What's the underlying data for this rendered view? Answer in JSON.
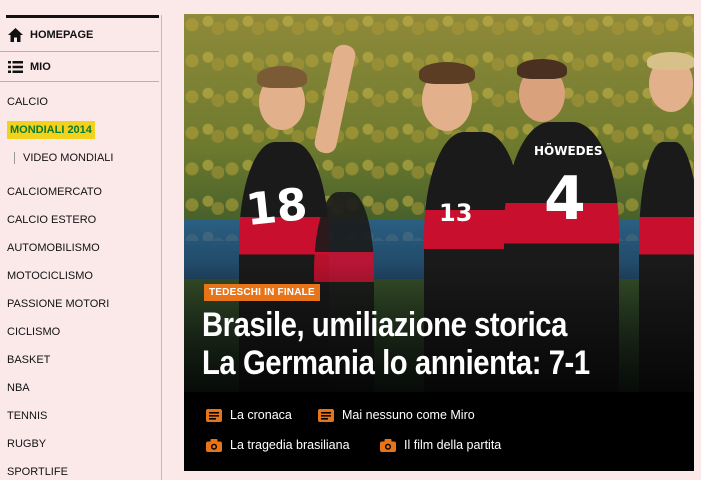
{
  "sidebar": {
    "homepage": "HOMEPAGE",
    "mio": "MIO",
    "items": [
      {
        "label": "CALCIO"
      },
      {
        "label": "MONDIALI 2014"
      },
      {
        "label": "VIDEO MONDIALI"
      },
      {
        "label": "CALCIOMERCATO"
      },
      {
        "label": "CALCIO ESTERO"
      },
      {
        "label": "AUTOMOBILISMO"
      },
      {
        "label": "MOTOCICLISMO"
      },
      {
        "label": "PASSIONE MOTORI"
      },
      {
        "label": "CICLISMO"
      },
      {
        "label": "BASKET"
      },
      {
        "label": "NBA"
      },
      {
        "label": "TENNIS"
      },
      {
        "label": "RUGBY"
      },
      {
        "label": "SPORTLIFE"
      }
    ]
  },
  "hero": {
    "kicker": "TEDESCHI IN FINALE",
    "headline_line1": "Brasile, umiliazione storica",
    "headline_line2": "La Germania lo annienta: 7-1",
    "jersey_numbers": {
      "left": "18",
      "center": "13",
      "right": "4"
    },
    "jersey_name": "HÖWEDES"
  },
  "links": [
    {
      "label": "La cronaca",
      "icon": "article-icon"
    },
    {
      "label": "Mai nessuno come Miro",
      "icon": "article-icon"
    },
    {
      "label": "La tragedia brasiliana",
      "icon": "camera-icon"
    },
    {
      "label": "Il film della partita",
      "icon": "camera-icon"
    }
  ],
  "colors": {
    "page_bg": "#fbe9ea",
    "highlight_bg": "#f2d21c",
    "highlight_text": "#0b7a32",
    "kicker_bg": "#e8741a",
    "icon_orange": "#e8741a"
  }
}
